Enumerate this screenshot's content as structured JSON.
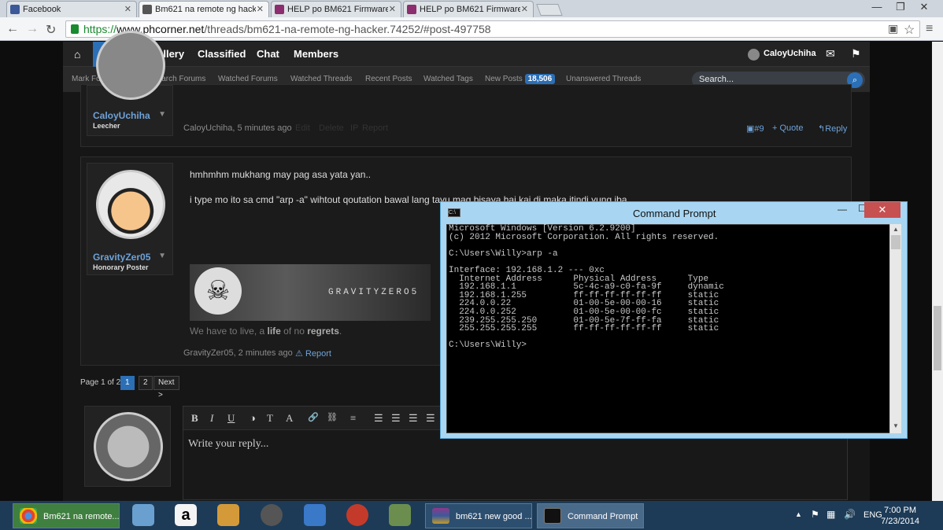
{
  "browser": {
    "tabs": [
      {
        "label": "Facebook",
        "color": "#3b5998"
      },
      {
        "label": "Bm621 na remote ng hack",
        "color": "#555555"
      },
      {
        "label": "HELP po BM621 Firmware",
        "color": "#8b2d6e"
      },
      {
        "label": "HELP po BM621 Firmware",
        "color": "#8b2d6e"
      }
    ],
    "url_scheme": "https://",
    "url_host": "www.phcorner.net",
    "url_path": "/threads/bm621-na-remote-ng-hacker.74252/#post-497758"
  },
  "nav": {
    "items": [
      "Forums",
      "Gallery",
      "Classified",
      "Chat",
      "Members"
    ],
    "user": "CaloyUchiha",
    "sub": [
      "Mark Forums Read",
      "Search Forums",
      "Watched Forums",
      "Watched Threads",
      "Recent Posts",
      "Watched Tags",
      "New Posts"
    ],
    "new_posts_count": "18,506",
    "unanswered": "Unanswered Threads",
    "search_placeholder": "Search..."
  },
  "post1": {
    "username": "CaloyUchiha",
    "usertitle": "Leecher",
    "meta": "CaloyUchiha, 5 minutes ago",
    "edit": "Edit",
    "delete": "Delete",
    "ip": "IP",
    "report": "Report",
    "num": "#9",
    "quote": "+ Quote",
    "reply": "Reply"
  },
  "post2": {
    "username": "GravityZer05",
    "usertitle": "Honorary Poster",
    "line1": "hmhmhm mukhang may pag asa yata yan..",
    "line2": "i type mo ito sa cmd \"arp -a\" wihtout qoutation bawal lang tayu mag bisaya hai kai di maka itindi yung iba.",
    "banner": "GRAVITYZERO5",
    "sig_pre": "We have to live, a ",
    "sig_a": "life",
    "sig_b": " of no ",
    "sig_c": "regrets",
    "sig_end": ".",
    "meta": "GravityZer05, 2 minutes ago",
    "report": "Report"
  },
  "pager": {
    "label": "Page 1 of 2",
    "pages": [
      "1",
      "2"
    ],
    "next": "Next >"
  },
  "editor": {
    "placeholder": "Write your reply...",
    "tools": [
      "B",
      "I",
      "U",
      "◑",
      "T",
      "A",
      "🔗",
      "⛓",
      "≡",
      "☰",
      "☰",
      "☰",
      "☰"
    ]
  },
  "cmd": {
    "title": "Command Prompt",
    "lines": [
      "Microsoft Windows [Version 6.2.9200]",
      "(c) 2012 Microsoft Corporation. All rights reserved.",
      "",
      "C:\\Users\\Willy>arp -a",
      "",
      "Interface: 192.168.1.2 --- 0xc",
      "  Internet Address      Physical Address      Type",
      "  192.168.1.1           5c-4c-a9-c0-fa-9f     dynamic",
      "  192.168.1.255         ff-ff-ff-ff-ff-ff     static",
      "  224.0.0.22            01-00-5e-00-00-16     static",
      "  224.0.0.252           01-00-5e-00-00-fc     static",
      "  239.255.255.250       01-00-5e-7f-ff-fa     static",
      "  255.255.255.255       ff-ff-ff-ff-ff-ff     static",
      "",
      "C:\\Users\\Willy>"
    ]
  },
  "taskbar": {
    "chrome_task": "Bm621 na remote...",
    "winrar_task": "bm621 new good ...",
    "cmd_task": "Command Prompt",
    "lang": "ENG",
    "time": "7:00 PM",
    "date": "7/23/2014"
  }
}
